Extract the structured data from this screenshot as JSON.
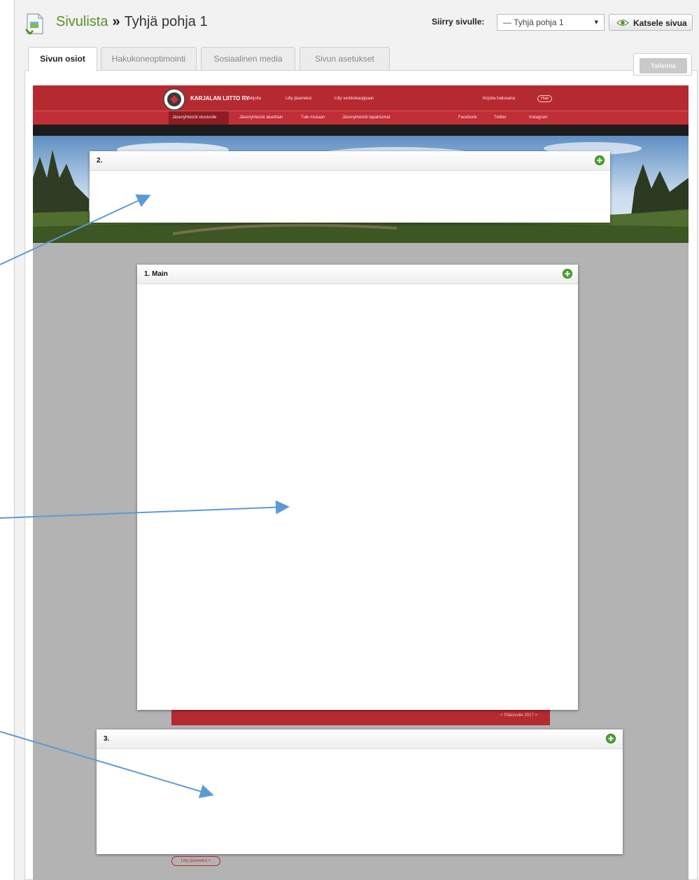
{
  "header": {
    "breadcrumb_link": "Sivulista",
    "breadcrumb_separator": "»",
    "page_title": "Tyhjä pohja 1",
    "goto_label": "Siirry sivulle:",
    "goto_selected": "— Tyhjä pohja 1",
    "view_button": "Katsele sivua",
    "icons": [
      "page-icon",
      "eye-icon",
      "chevron-down-icon"
    ]
  },
  "tabs": [
    {
      "label": "Sivun osiot",
      "active": true
    },
    {
      "label": "Hakukoneoptimointi",
      "active": false
    },
    {
      "label": "Sosiaalinen media",
      "active": false
    },
    {
      "label": "Sivun asetukset",
      "active": false
    }
  ],
  "save_button": "Tallenna",
  "preview": {
    "brand": "KARJALAN LIITTO RY",
    "nav_items": [
      "Lahjoita",
      "Liity jäseneksi",
      "Liity verkkokauppaan"
    ],
    "search": "Kirjoita hakusana",
    "search_button": "Hae",
    "subnav_items": [
      "Jäsenyhteisöt etusivulle",
      "Jäsenyhteisöt alueittain",
      "Tule mukaan",
      "Jäsenyhteisöt tapahtumat"
    ],
    "social": [
      "Facebook",
      "Twitter",
      "Instagram"
    ],
    "footer_link": "< Pääsivulle 2017 >",
    "bottom_pill": "Liity jäseneksi >",
    "colors": {
      "brand_red": "#b52a31",
      "canvas_gray": "#b3b3b3"
    }
  },
  "zones": [
    {
      "title": "2."
    },
    {
      "title": "1. Main"
    },
    {
      "title": "3."
    }
  ]
}
